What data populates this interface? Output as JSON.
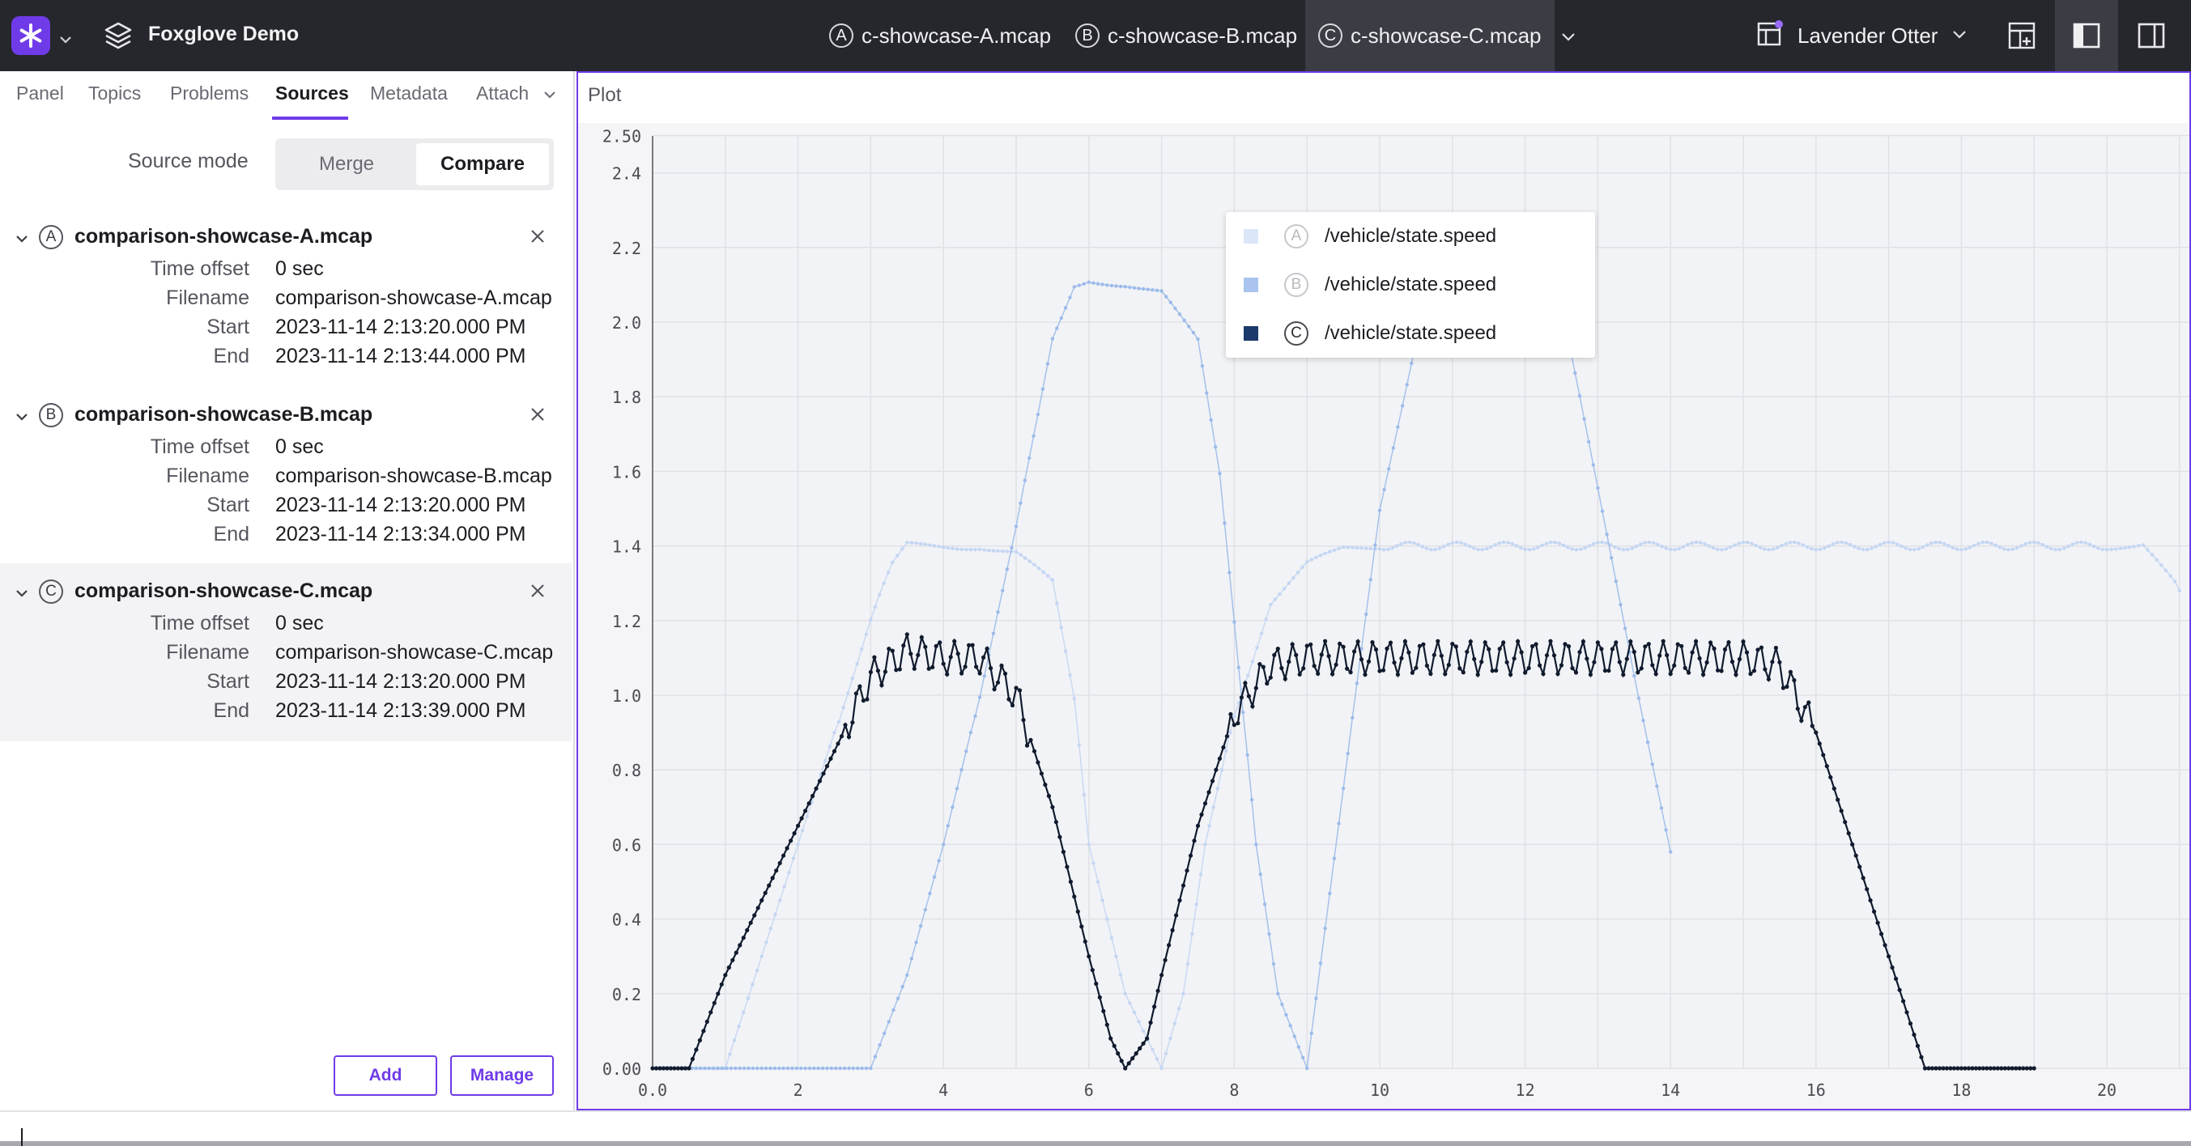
{
  "app": {
    "title": "Foxglove Demo",
    "brand_color": "#6f3be8"
  },
  "file_tabs": [
    {
      "badge": "A",
      "label": "c-showcase-A.mcap",
      "active": false
    },
    {
      "badge": "B",
      "label": "c-showcase-B.mcap",
      "active": false
    },
    {
      "badge": "C",
      "label": "c-showcase-C.mcap",
      "active": true
    }
  ],
  "user": {
    "name": "Lavender Otter"
  },
  "sidebar": {
    "tabs": [
      "Panel",
      "Topics",
      "Problems",
      "Sources",
      "Metadata",
      "Attach"
    ],
    "active_tab": "Sources",
    "source_mode_label": "Source mode",
    "mode_options": [
      "Merge",
      "Compare"
    ],
    "selected_mode": "Compare",
    "field_labels": {
      "time_offset": "Time offset",
      "filename": "Filename",
      "start": "Start",
      "end": "End"
    },
    "sources": [
      {
        "badge": "A",
        "name": "comparison-showcase-A.mcap",
        "time_offset": "0 sec",
        "filename": "comparison-showcase-A.mcap",
        "start": "2023-11-14 2:13:20.000 PM",
        "end": "2023-11-14 2:13:44.000 PM"
      },
      {
        "badge": "B",
        "name": "comparison-showcase-B.mcap",
        "time_offset": "0 sec",
        "filename": "comparison-showcase-B.mcap",
        "start": "2023-11-14 2:13:20.000 PM",
        "end": "2023-11-14 2:13:34.000 PM"
      },
      {
        "badge": "C",
        "name": "comparison-showcase-C.mcap",
        "time_offset": "0 sec",
        "filename": "comparison-showcase-C.mcap",
        "start": "2023-11-14 2:13:20.000 PM",
        "end": "2023-11-14 2:13:39.000 PM"
      }
    ],
    "add_label": "Add",
    "manage_label": "Manage"
  },
  "plot": {
    "panel_title": "Plot",
    "legend": [
      {
        "badge": "A",
        "topic": "/vehicle/state.speed",
        "color": "#dbe6f8",
        "visible": false
      },
      {
        "badge": "B",
        "topic": "/vehicle/state.speed",
        "color": "#a9c4ee",
        "visible": false
      },
      {
        "badge": "C",
        "topic": "/vehicle/state.speed",
        "color": "#1b3a6b",
        "visible": true
      }
    ]
  },
  "chart_data": {
    "type": "line",
    "title": "",
    "xlabel": "",
    "ylabel": "",
    "xlim": [
      0,
      21
    ],
    "ylim": [
      0,
      2.5
    ],
    "x_ticks": [
      "0.0",
      "2",
      "4",
      "6",
      "8",
      "10",
      "12",
      "14",
      "16",
      "18",
      "20"
    ],
    "y_ticks": [
      "0.00",
      "0.2",
      "0.4",
      "0.6",
      "0.8",
      "1.0",
      "1.2",
      "1.4",
      "1.6",
      "1.8",
      "2.0",
      "2.2",
      "2.4",
      "2.50"
    ],
    "grid": true,
    "series": [
      {
        "name": "A",
        "color": "#c4d6f3",
        "x": [
          0,
          1.0,
          1.5,
          2.0,
          2.5,
          3.0,
          3.3,
          3.5,
          4.0,
          4.5,
          5.0,
          5.5,
          5.8,
          6.0,
          6.5,
          7.0,
          7.3,
          7.6,
          8.0,
          8.5,
          9.0,
          9.5,
          10.0,
          11,
          12,
          13,
          14,
          15,
          16,
          17,
          18,
          19,
          20,
          20.5,
          21
        ],
        "y": [
          0,
          0,
          0.3,
          0.6,
          0.9,
          1.2,
          1.35,
          1.4,
          1.4,
          1.4,
          1.38,
          1.3,
          1.0,
          0.6,
          0.2,
          0.0,
          0.2,
          0.6,
          0.95,
          1.25,
          1.35,
          1.39,
          1.4,
          1.4,
          1.4,
          1.4,
          1.4,
          1.4,
          1.4,
          1.4,
          1.4,
          1.4,
          1.4,
          1.4,
          1.28
        ]
      },
      {
        "name": "B",
        "color": "#9cbbe9",
        "x": [
          0,
          3.0,
          3.5,
          4.0,
          4.5,
          5.0,
          5.3,
          5.5,
          5.8,
          6.0,
          6.5,
          7.0,
          7.5,
          7.8,
          8.0,
          8.3,
          8.6,
          9.0,
          9.5,
          10.0,
          10.5,
          11.0,
          11.5,
          12.0,
          12.5,
          13.0,
          13.5,
          14.0
        ],
        "y": [
          0,
          0,
          0.25,
          0.6,
          1.0,
          1.45,
          1.75,
          1.95,
          2.1,
          2.11,
          2.1,
          2.08,
          1.95,
          1.6,
          1.2,
          0.6,
          0.2,
          0.0,
          0.75,
          1.5,
          1.95,
          2.08,
          2.1,
          2.11,
          2.05,
          1.55,
          1.05,
          0.58
        ]
      },
      {
        "name": "C",
        "color": "#111b2e",
        "x": [
          0,
          0.5,
          1.0,
          1.5,
          2.0,
          2.5,
          3.0,
          3.5,
          4.0,
          4.5,
          5.0,
          5.5,
          6.0,
          6.3,
          6.5,
          6.8,
          7.0,
          7.5,
          8.0,
          8.5,
          9.0,
          9.5,
          10.0,
          11,
          12,
          13,
          14,
          15,
          15.5,
          16.0,
          16.5,
          17.0,
          17.5,
          18,
          19
        ],
        "y": [
          0,
          0,
          0.25,
          0.45,
          0.65,
          0.85,
          1.05,
          1.12,
          1.1,
          1.1,
          1.0,
          0.7,
          0.3,
          0.08,
          0.0,
          0.08,
          0.25,
          0.65,
          0.95,
          1.08,
          1.1,
          1.1,
          1.1,
          1.1,
          1.1,
          1.1,
          1.1,
          1.1,
          1.08,
          0.9,
          0.6,
          0.3,
          0.0,
          0.0,
          0.0
        ]
      }
    ]
  }
}
